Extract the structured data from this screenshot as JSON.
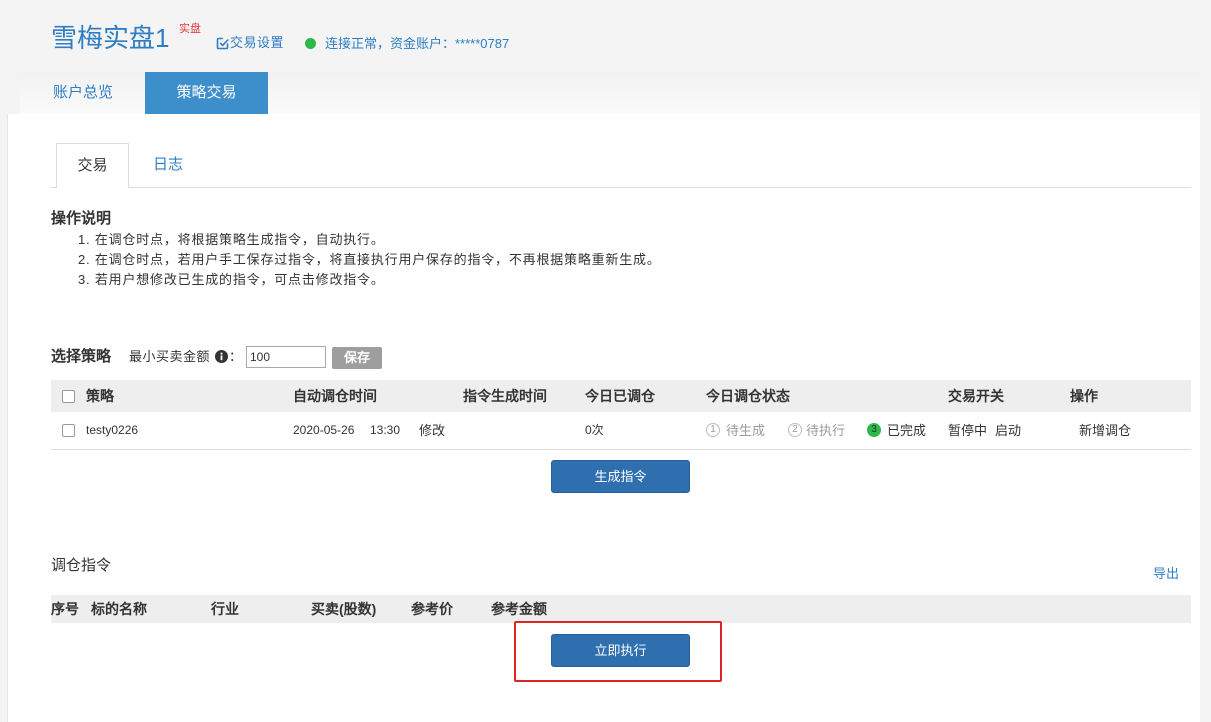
{
  "colors": {
    "brand": "#2f7dc3",
    "tab_active": "#3d8fcc",
    "button": "#2f6fb0",
    "danger": "#e4393c",
    "success": "#2fb84a",
    "highlight": "#e02424",
    "muted": "#9a9a9a",
    "save_button": "#9e9e9e"
  },
  "header": {
    "title": "雪梅实盘1",
    "badge": "实盘",
    "settings_icon": "edit-square-icon",
    "settings_label": "交易设置",
    "status_icon": "status-dot-icon",
    "status_text": "连接正常，资金账户：*****0787"
  },
  "main_tabs": [
    {
      "label": "账户总览",
      "active": false
    },
    {
      "label": "策略交易",
      "active": true
    }
  ],
  "sub_tabs": [
    {
      "label": "交易",
      "active": true
    },
    {
      "label": "日志",
      "active": false
    }
  ],
  "instructions": {
    "title": "操作说明",
    "items": [
      "1. 在调仓时点，将根据策略生成指令，自动执行。",
      "2. 在调仓时点，若用户手工保存过指令，将直接执行用户保存的指令，不再根据策略重新生成。",
      "3. 若用户想修改已生成的指令，可点击修改指令。"
    ]
  },
  "strategy_select": {
    "title": "选择策略",
    "min_amount_label": "最小买卖金额",
    "info_icon": "info-circle-icon",
    "colon": "：",
    "min_amount_value": "100",
    "save_label": "保存"
  },
  "strategy_table": {
    "columns": [
      "策略",
      "自动调仓时间",
      "指令生成时间",
      "今日已调仓",
      "今日调仓状态",
      "交易开关",
      "操作"
    ],
    "rows": [
      {
        "checked": false,
        "name": "testy0226",
        "auto_date": "2020-05-26",
        "auto_time": "13:30",
        "modify_label": "修改",
        "today_count": "0次",
        "status_steps": [
          {
            "num": "1",
            "label": "待生成",
            "done": false
          },
          {
            "num": "2",
            "label": "待执行",
            "done": false
          },
          {
            "num": "3",
            "label": "已完成",
            "done": true
          }
        ],
        "switch_state": "暂停中",
        "switch_action": "启动",
        "action": "新增调仓"
      }
    ]
  },
  "generate_button": {
    "label": "生成指令"
  },
  "orders": {
    "title": "调仓指令",
    "export_label": "导出",
    "columns": [
      "序号",
      "标的名称",
      "行业",
      "买卖(股数)",
      "参考价",
      "参考金额"
    ]
  },
  "execute_button": {
    "label": "立即执行"
  }
}
